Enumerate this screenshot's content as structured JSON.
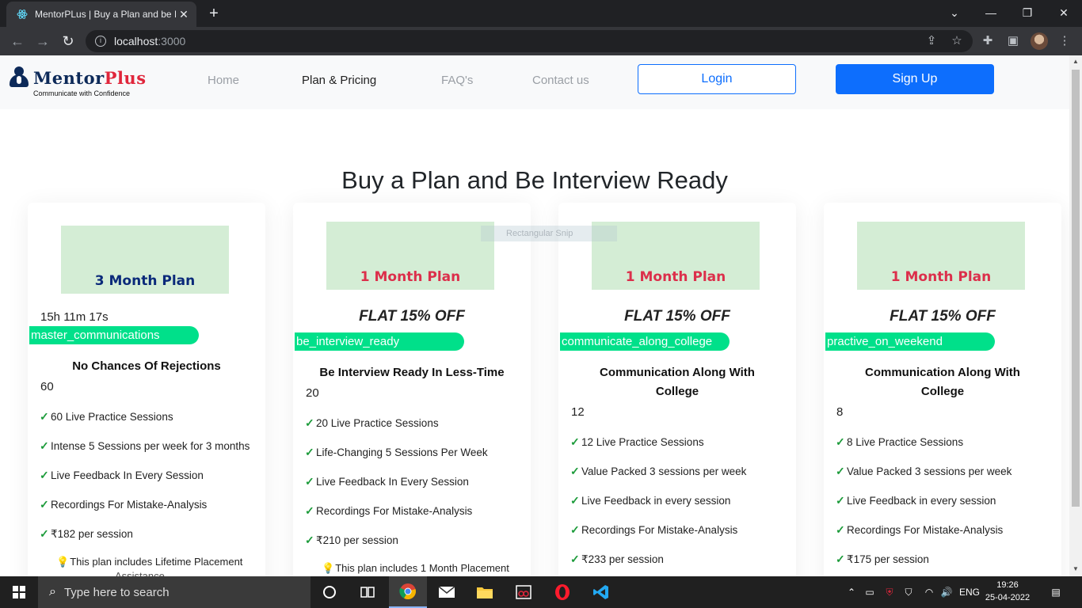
{
  "browser": {
    "tab_title": "MentorPLus | Buy a Plan and be I",
    "tab_close": "✕",
    "new_tab": "+",
    "url_host": "localhost",
    "url_port": ":3000",
    "win_min": "⌄",
    "win_minimize": "—",
    "win_restore": "❐",
    "win_close": "✕"
  },
  "navbar": {
    "brand_main": "Mentor",
    "brand_plus": "Plus",
    "tagline": "Communicate with Confidence",
    "links": [
      "Home",
      "Plan & Pricing",
      "FAQ's",
      "Contact us"
    ],
    "login": "Login",
    "signup": "Sign Up"
  },
  "heading": "Buy a Plan and Be Interview Ready",
  "snip_overlay": "Rectangular Snip",
  "cards": [
    {
      "banner": "3 Month Plan",
      "timer": "15h 11m 17s",
      "code": "master_communications",
      "title": "No Chances Of Rejections",
      "sessions": "60",
      "features": [
        "60 Live Practice Sessions",
        "Intense 5 Sessions per week for 3 months",
        "Live Feedback In Every Session",
        "Recordings For Mistake-Analysis",
        "₹182 per session"
      ],
      "note": "This plan includes Lifetime Placement",
      "note_cont": "Assistance"
    },
    {
      "banner": "1 Month Plan",
      "offer": "FLAT 15% OFF",
      "code": "be_interview_ready",
      "title": "Be Interview Ready In Less-Time",
      "sessions": "20",
      "features": [
        "20 Live Practice Sessions",
        "Life-Changing 5 Sessions Per Week",
        "Live Feedback In Every Session",
        "Recordings For Mistake-Analysis",
        "₹210 per session"
      ],
      "note": "This plan includes 1 Month Placement"
    },
    {
      "banner": "1 Month Plan",
      "offer": "FLAT 15% OFF",
      "code": "communicate_along_college",
      "title_line1": "Communication Along With",
      "title_line2": "College",
      "sessions": "12",
      "features": [
        "12 Live Practice Sessions",
        "Value Packed 3 sessions per week",
        "Live Feedback in every session",
        "Recordings For Mistake-Analysis",
        "₹233 per session"
      ]
    },
    {
      "banner": "1 Month Plan",
      "offer": "FLAT 15% OFF",
      "code": "practive_on_weekend",
      "title_line1": "Communication Along With",
      "title_line2": "College",
      "sessions": "8",
      "features": [
        "8 Live Practice Sessions",
        "Value Packed 3 sessions per week",
        "Live Feedback in every session",
        "Recordings For Mistake-Analysis",
        "₹175 per session"
      ]
    }
  ],
  "taskbar": {
    "search_placeholder": "Type here to search",
    "lang": "ENG",
    "time": "19:26",
    "date": "25-04-2022"
  },
  "colors": {
    "primary": "#0d6efd",
    "promo_pill": "#00e08a",
    "banner_bg": "#d4edd5",
    "banner_blue_text": "#0b2a7a",
    "banner_red_text": "#dc2f4b",
    "check": "#1c9b3a"
  }
}
